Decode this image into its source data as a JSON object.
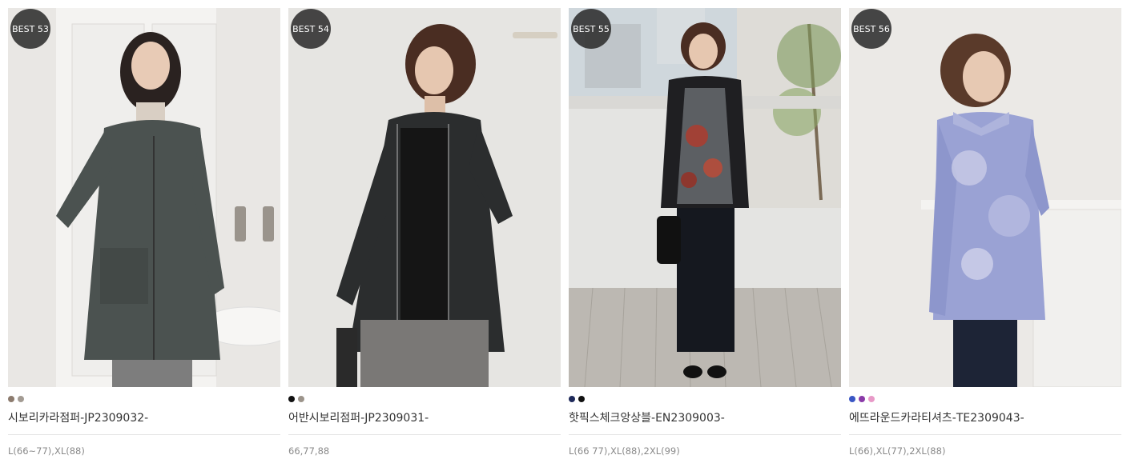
{
  "products": [
    {
      "badge": "BEST 53",
      "name": "시보리카라점퍼-JP2309032-",
      "sizes": "L(66~77),XL(88)",
      "colors": [
        "#8c7b6e",
        "#a39b93"
      ]
    },
    {
      "badge": "BEST 54",
      "name": "어반시보리점퍼-JP2309031-",
      "sizes": "66,77,88",
      "colors": [
        "#111111",
        "#9c948b"
      ]
    },
    {
      "badge": "BEST 55",
      "name": "핫픽스체크앙상블-EN2309003-",
      "sizes": "L(66 77),XL(88),2XL(99)",
      "colors": [
        "#1f2a5a",
        "#111111"
      ]
    },
    {
      "badge": "BEST 56",
      "name": "에뜨라운드카라티셔츠-TE2309043-",
      "sizes": "L(66),XL(77),2XL(88)",
      "colors": [
        "#3a56c4",
        "#8a3aa8",
        "#e89ac8"
      ]
    }
  ]
}
